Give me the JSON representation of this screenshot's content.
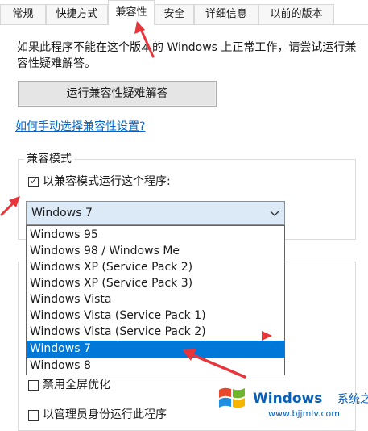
{
  "tabs": [
    {
      "label": "常规",
      "active": false
    },
    {
      "label": "快捷方式",
      "active": false
    },
    {
      "label": "兼容性",
      "active": true
    },
    {
      "label": "安全",
      "active": false
    },
    {
      "label": "详细信息",
      "active": false
    },
    {
      "label": "以前的版本",
      "active": false
    }
  ],
  "compat": {
    "description": "如果此程序不能在这个版本的 Windows 上正常工作，请尝试运行兼容性疑难解答。",
    "troubleshooter_button": "运行兼容性疑难解答",
    "manual_link": "如何手动选择兼容性设置?"
  },
  "compat_mode": {
    "group_title": "兼容模式",
    "run_in_compat_label": "以兼容模式运行这个程序:",
    "run_in_compat_checked": true,
    "selected_os": "Windows 7",
    "options": [
      "Windows 95",
      "Windows 98 / Windows Me",
      "Windows XP (Service Pack 2)",
      "Windows XP (Service Pack 3)",
      "Windows Vista",
      "Windows Vista (Service Pack 1)",
      "Windows Vista (Service Pack 2)",
      "Windows 7",
      "Windows 8"
    ],
    "selected_index": 7
  },
  "settings": {
    "disable_fullscreen_label": "禁用全屏优化",
    "disable_fullscreen_checked": false,
    "run_as_admin_label": "以管理员身份运行此程序",
    "run_as_admin_checked": false
  },
  "watermark": {
    "brand": "Windows",
    "site_name": "系统之家",
    "url": "www.bjjmlv.com"
  },
  "colors": {
    "annotation_arrow": "#e8343b",
    "selection": "#0078d7",
    "link": "#0066cc"
  }
}
